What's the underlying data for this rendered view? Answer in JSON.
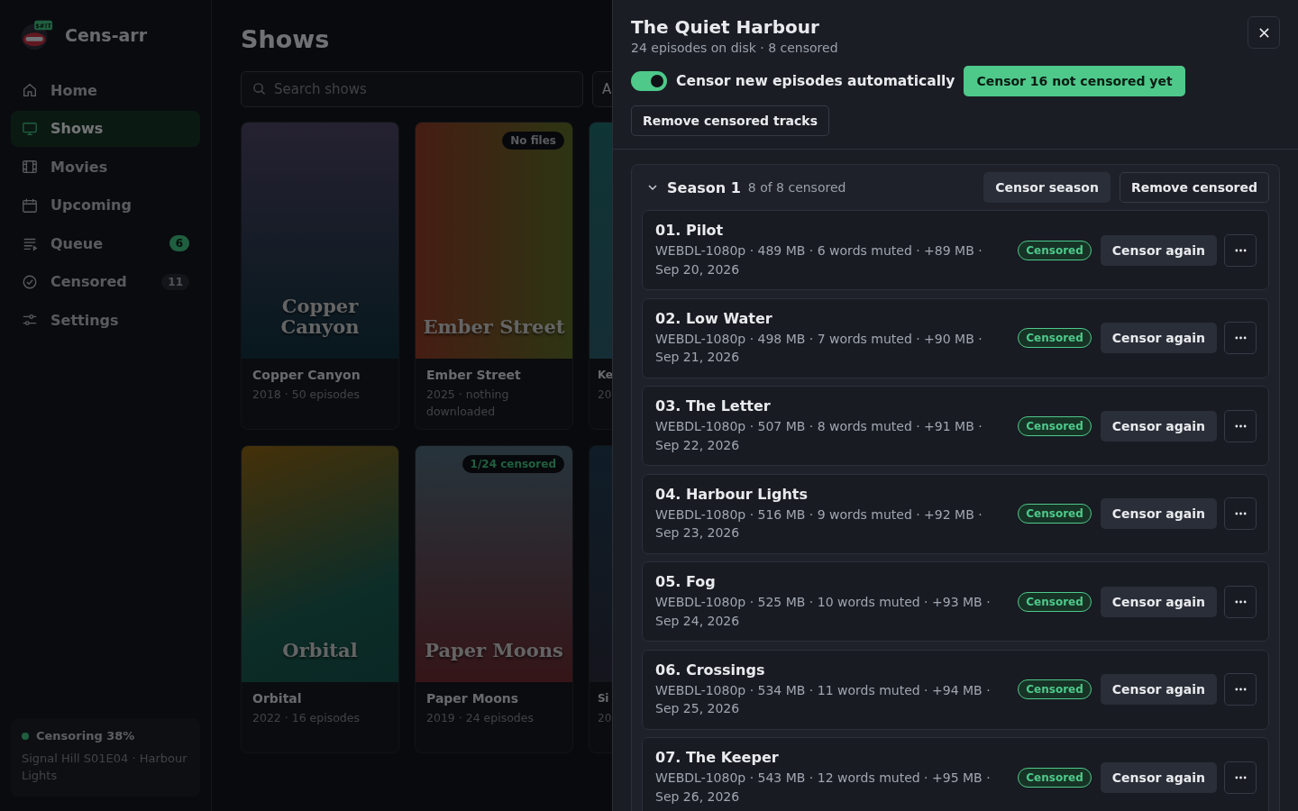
{
  "app": {
    "name": "Cens-arr",
    "logo_badge": "$#!T"
  },
  "sidebar": {
    "items": [
      {
        "label": "Home",
        "selected": false
      },
      {
        "label": "Shows",
        "selected": true
      },
      {
        "label": "Movies",
        "selected": false
      },
      {
        "label": "Upcoming",
        "selected": false
      },
      {
        "label": "Queue",
        "selected": false,
        "badge": {
          "text": "6",
          "kind": "accent"
        }
      },
      {
        "label": "Censored",
        "selected": false,
        "badge": {
          "text": "11",
          "kind": "muted"
        }
      },
      {
        "label": "Settings",
        "selected": false
      }
    ],
    "status": {
      "title": "Censoring 38%",
      "detail": "Signal Hill S01E04 · Harbour Lights"
    }
  },
  "page": {
    "title": "Shows",
    "search": {
      "placeholder": "Search shows"
    },
    "filter_button": "A",
    "shows": [
      {
        "title": "Copper Canyon",
        "poster_title": "Copper Canyon",
        "meta": "2018 · 50 episodes"
      },
      {
        "title": "Ember Street",
        "poster_title": "Ember Street",
        "meta": "2025 · nothing downloaded",
        "badge": {
          "text": "No files",
          "kind": "muted"
        }
      },
      {
        "title": "Ke",
        "meta": "20"
      },
      {
        "title": "Orbital",
        "poster_title": "Orbital",
        "meta": "2022 · 16 episodes"
      },
      {
        "title": "Paper Moons",
        "poster_title": "Paper Moons",
        "meta": "2019 · 24 episodes",
        "badge": {
          "text": "1/24 censored",
          "kind": "accent"
        }
      },
      {
        "title": "Si",
        "meta": "20"
      }
    ]
  },
  "drawer": {
    "title": "The Quiet Harbour",
    "subtitle": "24 episodes on disk · 8 censored",
    "auto_toggle": {
      "label": "Censor new episodes automatically",
      "on": true
    },
    "primary_button": "Censor 16 not censored yet",
    "secondary_button": "Remove censored tracks",
    "season": {
      "title": "Season 1",
      "summary": "8 of 8 censored",
      "expanded": true,
      "buttons": [
        "Censor season",
        "Remove censored"
      ],
      "episodes": [
        {
          "title": "01. Pilot",
          "meta": "WEBDL-1080p · 489 MB · 6 words muted · +89 MB · Sep 20, 2026",
          "status": {
            "text": "Censored",
            "kind": "censored"
          },
          "action": "Censor again"
        },
        {
          "title": "02. Low Water",
          "meta": "WEBDL-1080p · 498 MB · 7 words muted · +90 MB · Sep 21, 2026",
          "status": {
            "text": "Censored",
            "kind": "censored"
          },
          "action": "Censor again"
        },
        {
          "title": "03. The Letter",
          "meta": "WEBDL-1080p · 507 MB · 8 words muted · +91 MB · Sep 22, 2026",
          "status": {
            "text": "Censored",
            "kind": "censored"
          },
          "action": "Censor again"
        },
        {
          "title": "04. Harbour Lights",
          "meta": "WEBDL-1080p · 516 MB · 9 words muted · +92 MB · Sep 23, 2026",
          "status": {
            "text": "Censored",
            "kind": "censored"
          },
          "action": "Censor again"
        },
        {
          "title": "05. Fog",
          "meta": "WEBDL-1080p · 525 MB · 10 words muted · +93 MB · Sep 24, 2026",
          "status": {
            "text": "Censored",
            "kind": "censored"
          },
          "action": "Censor again"
        },
        {
          "title": "06. Crossings",
          "meta": "WEBDL-1080p · 534 MB · 11 words muted · +94 MB · Sep 25, 2026",
          "status": {
            "text": "Censored",
            "kind": "censored"
          },
          "action": "Censor again"
        },
        {
          "title": "07. The Keeper",
          "meta": "WEBDL-1080p · 543 MB · 12 words muted · +95 MB · Sep 26, 2026",
          "status": {
            "text": "Censored",
            "kind": "censored"
          },
          "action": "Censor again"
        }
      ]
    }
  }
}
